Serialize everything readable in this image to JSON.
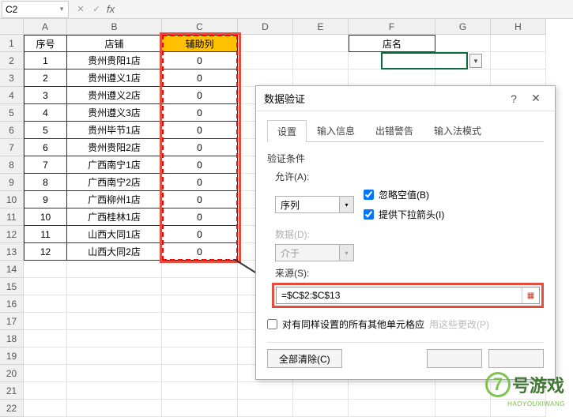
{
  "name_box": "C2",
  "col_letters": [
    "A",
    "B",
    "C",
    "D",
    "E",
    "F",
    "G",
    "H"
  ],
  "row_numbers": [
    1,
    2,
    3,
    4,
    5,
    6,
    7,
    8,
    9,
    10,
    11,
    12,
    13,
    14,
    15,
    16,
    17,
    18,
    19,
    20,
    21,
    22
  ],
  "headers": {
    "a1": "序号",
    "b1": "店铺",
    "c1": "辅助列",
    "f1": "店名"
  },
  "table": [
    {
      "seq": "1",
      "shop": "贵州贵阳1店",
      "aux": "0"
    },
    {
      "seq": "2",
      "shop": "贵州遵义1店",
      "aux": "0"
    },
    {
      "seq": "3",
      "shop": "贵州遵义2店",
      "aux": "0"
    },
    {
      "seq": "4",
      "shop": "贵州遵义3店",
      "aux": "0"
    },
    {
      "seq": "5",
      "shop": "贵州毕节1店",
      "aux": "0"
    },
    {
      "seq": "6",
      "shop": "贵州贵阳2店",
      "aux": "0"
    },
    {
      "seq": "7",
      "shop": "广西南宁1店",
      "aux": "0"
    },
    {
      "seq": "8",
      "shop": "广西南宁2店",
      "aux": "0"
    },
    {
      "seq": "9",
      "shop": "广西柳州1店",
      "aux": "0"
    },
    {
      "seq": "10",
      "shop": "广西桂林1店",
      "aux": "0"
    },
    {
      "seq": "11",
      "shop": "山西大同1店",
      "aux": "0"
    },
    {
      "seq": "12",
      "shop": "山西大同2店",
      "aux": "0"
    }
  ],
  "dialog": {
    "title": "数据验证",
    "tabs": {
      "settings": "设置",
      "input": "输入信息",
      "error": "出错警告",
      "ime": "输入法模式"
    },
    "criteria_label": "验证条件",
    "allow_label": "允许(A):",
    "allow_value": "序列",
    "data_label": "数据(D):",
    "data_value": "介于",
    "ignore_blank": "忽略空值(B)",
    "dropdown": "提供下拉箭头(I)",
    "source_label": "来源(S):",
    "source_value": "=$C$2:$C$13",
    "apply_all": "对有同样设置的所有其他单元格应",
    "apply_all_muted": "用这些更改(P)",
    "clear": "全部清除(C)"
  },
  "watermark": {
    "num": "7",
    "text": "号游戏",
    "sub": "HAOYOUXIWANG"
  }
}
